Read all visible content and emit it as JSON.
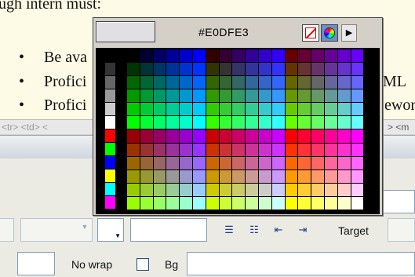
{
  "document": {
    "lines": [
      {
        "text": "ugh intern must:",
        "bullet": false
      },
      {
        "text": "Be ava",
        "bullet": true
      },
      {
        "text": "Profici",
        "bullet": true
      },
      {
        "text": "Profici",
        "bullet": true
      }
    ],
    "right_fragments": [
      "ML",
      "ewor"
    ],
    "bullet_char": "•"
  },
  "tag_selector": {
    "left_text": "<tr> <td> <",
    "right_text": "> <m"
  },
  "properties": {
    "target_label": "Target",
    "nowrap_label": "No wrap",
    "bg_label": "Bg",
    "list_icons": [
      "unordered-list-icon",
      "ordered-list-icon",
      "outdent-icon",
      "indent-icon"
    ]
  },
  "color_picker": {
    "hex_value": "#E0DFE3",
    "preview_color": "#e0dfe3",
    "menu_arrow": "▶",
    "left_column_colors": [
      "#000000",
      "#333333",
      "#666666",
      "#999999",
      "#cccccc",
      "#ffffff",
      "#ff0000",
      "#00ff00",
      "#0000ff",
      "#ffff00",
      "#00ffff",
      "#ff00ff"
    ]
  }
}
